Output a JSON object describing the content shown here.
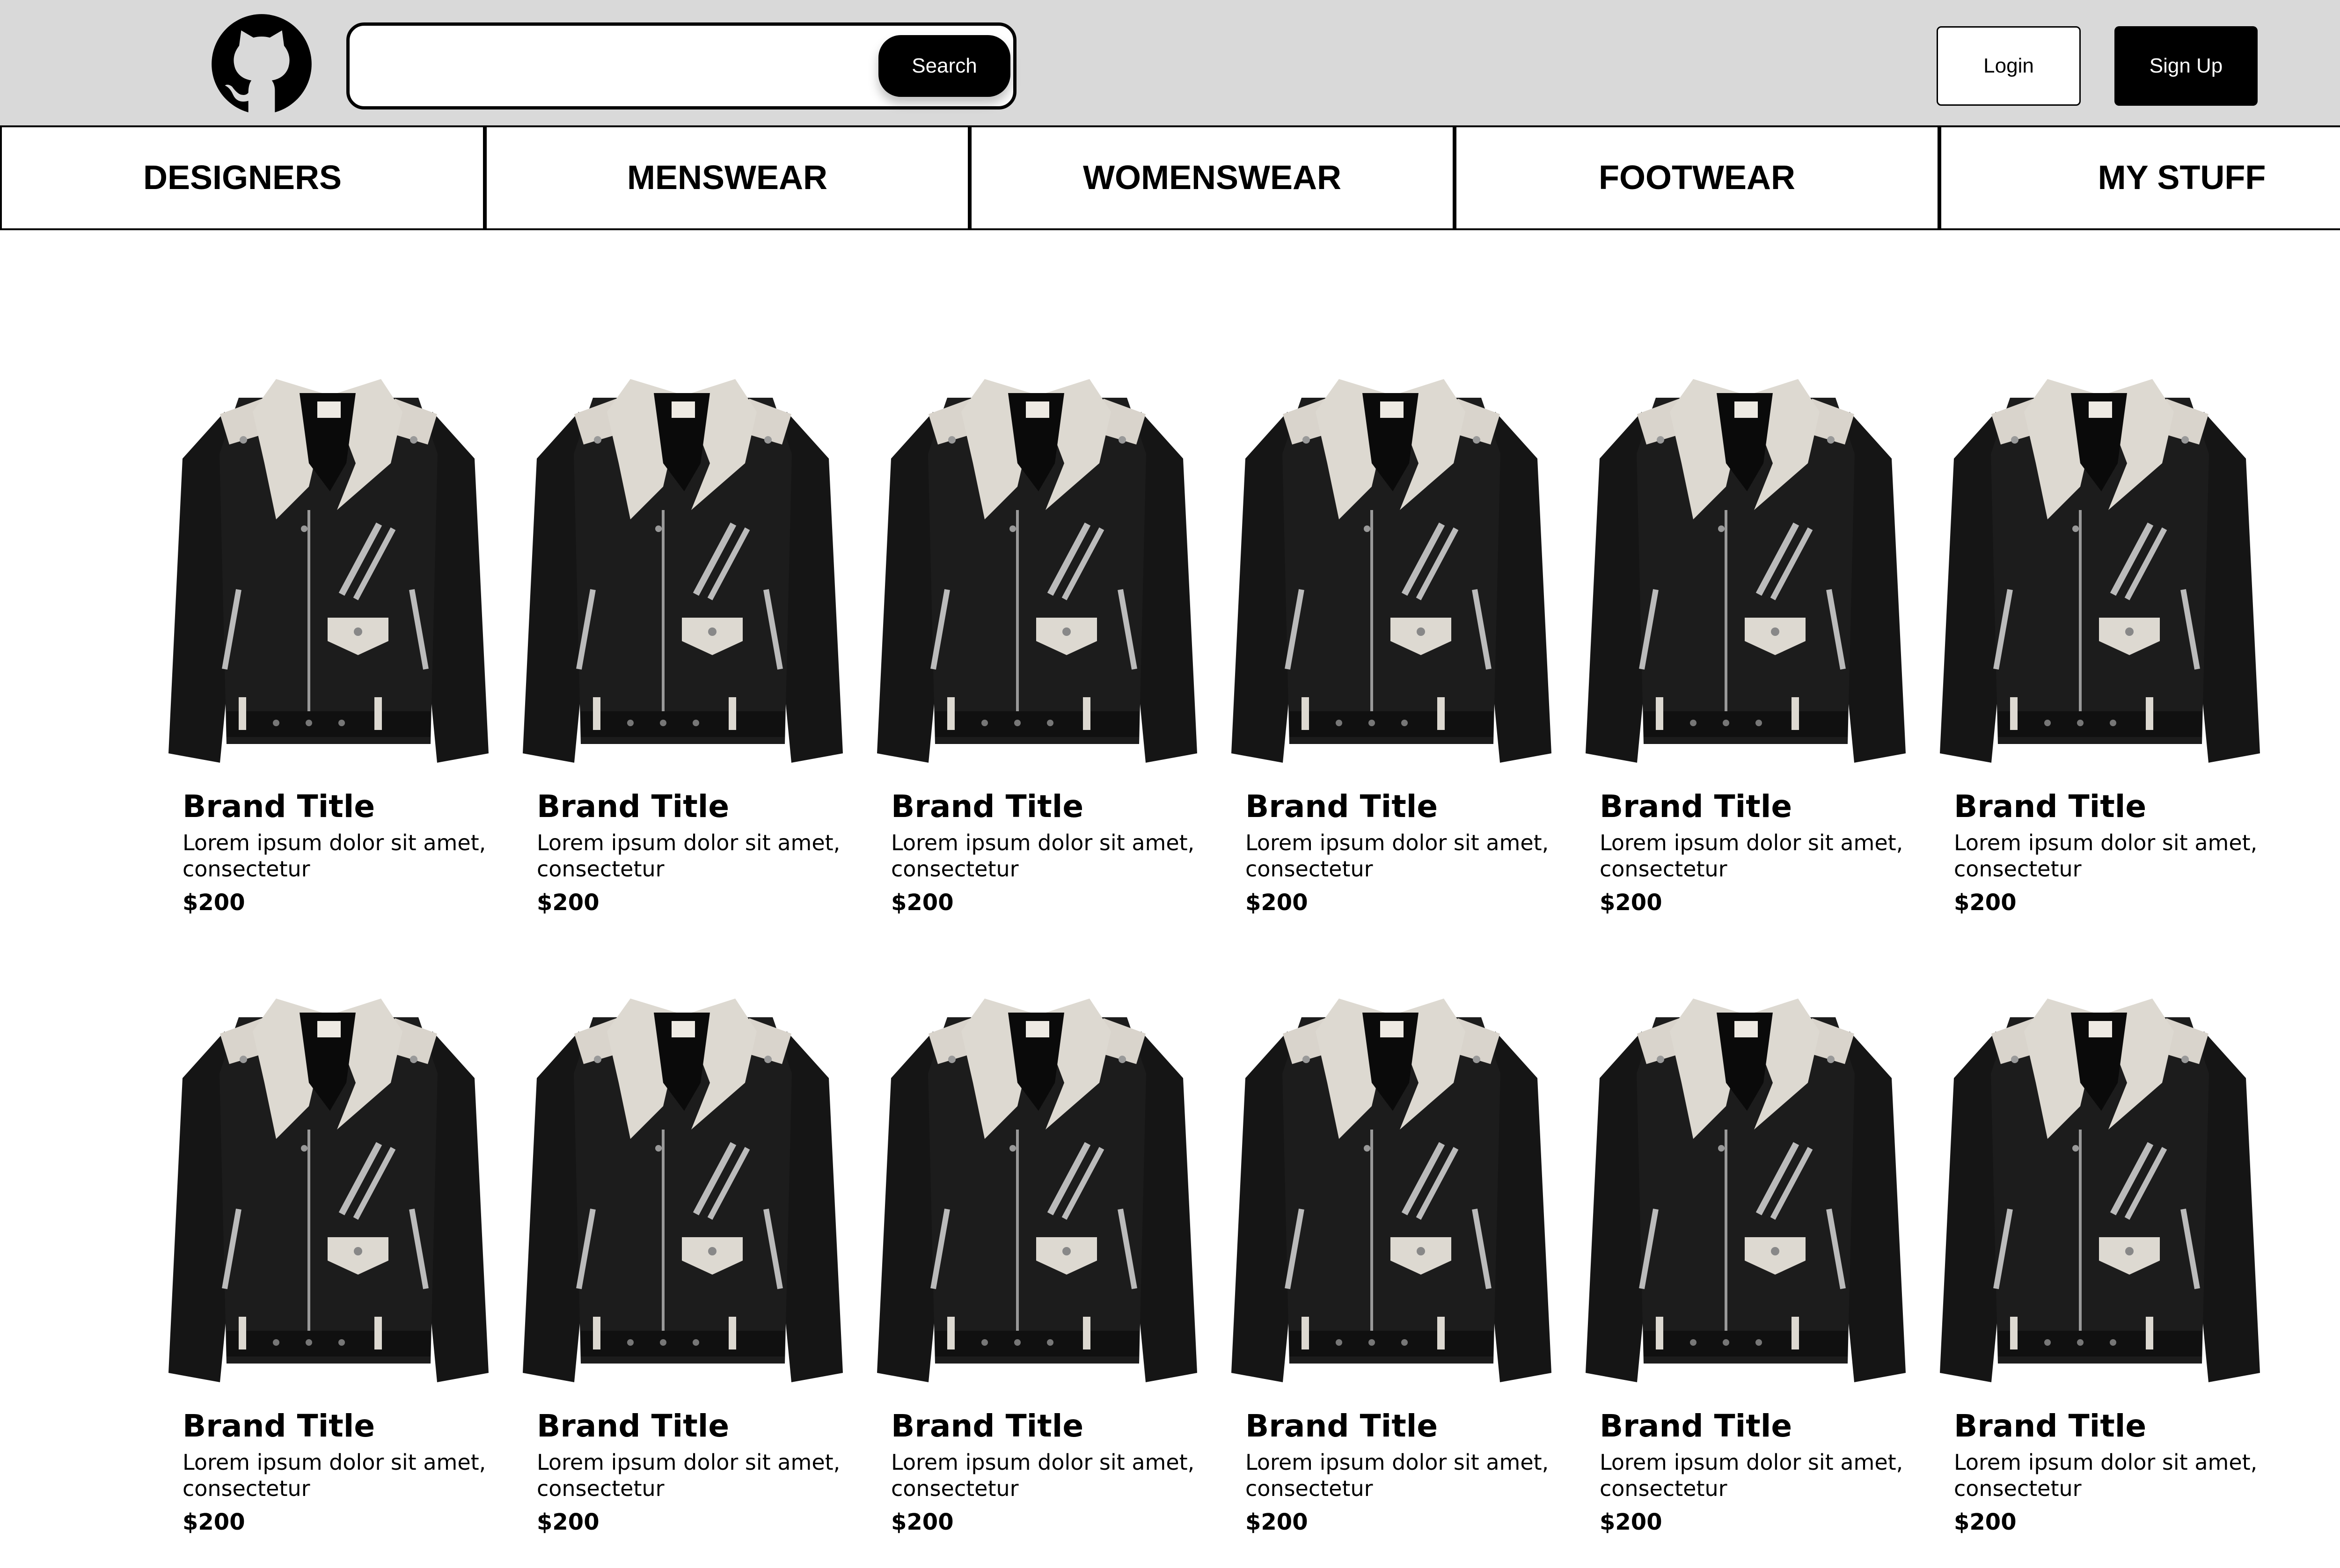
{
  "header": {
    "logo_icon": "github-octocat-icon",
    "search": {
      "value": "",
      "placeholder": "",
      "button_label": "Search"
    },
    "login_label": "Login",
    "signup_label": "Sign Up",
    "background": "#d9d9d9"
  },
  "nav": {
    "tabs": [
      {
        "label": "DESIGNERS"
      },
      {
        "label": "MENSWEAR"
      },
      {
        "label": "WOMENSWEAR"
      },
      {
        "label": "FOOTWEAR"
      },
      {
        "label": "MY STUFF"
      }
    ]
  },
  "products": [
    {
      "brand": "Brand Title",
      "description": "Lorem ipsum dolor sit amet, consectetur",
      "price": "$200",
      "image_icon": "leather-jacket-image"
    },
    {
      "brand": "Brand Title",
      "description": "Lorem ipsum dolor sit amet, consectetur",
      "price": "$200",
      "image_icon": "leather-jacket-image"
    },
    {
      "brand": "Brand Title",
      "description": "Lorem ipsum dolor sit amet, consectetur",
      "price": "$200",
      "image_icon": "leather-jacket-image"
    },
    {
      "brand": "Brand Title",
      "description": "Lorem ipsum dolor sit amet, consectetur",
      "price": "$200",
      "image_icon": "leather-jacket-image"
    },
    {
      "brand": "Brand Title",
      "description": "Lorem ipsum dolor sit amet, consectetur",
      "price": "$200",
      "image_icon": "leather-jacket-image"
    },
    {
      "brand": "Brand Title",
      "description": "Lorem ipsum dolor sit amet, consectetur",
      "price": "$200",
      "image_icon": "leather-jacket-image"
    },
    {
      "brand": "Brand Title",
      "description": "Lorem ipsum dolor sit amet, consectetur",
      "price": "$200",
      "image_icon": "leather-jacket-image"
    },
    {
      "brand": "Brand Title",
      "description": "Lorem ipsum dolor sit amet, consectetur",
      "price": "$200",
      "image_icon": "leather-jacket-image"
    },
    {
      "brand": "Brand Title",
      "description": "Lorem ipsum dolor sit amet, consectetur",
      "price": "$200",
      "image_icon": "leather-jacket-image"
    },
    {
      "brand": "Brand Title",
      "description": "Lorem ipsum dolor sit amet, consectetur",
      "price": "$200",
      "image_icon": "leather-jacket-image"
    },
    {
      "brand": "Brand Title",
      "description": "Lorem ipsum dolor sit amet, consectetur",
      "price": "$200",
      "image_icon": "leather-jacket-image"
    },
    {
      "brand": "Brand Title",
      "description": "Lorem ipsum dolor sit amet, consectetur",
      "price": "$200",
      "image_icon": "leather-jacket-image"
    }
  ]
}
